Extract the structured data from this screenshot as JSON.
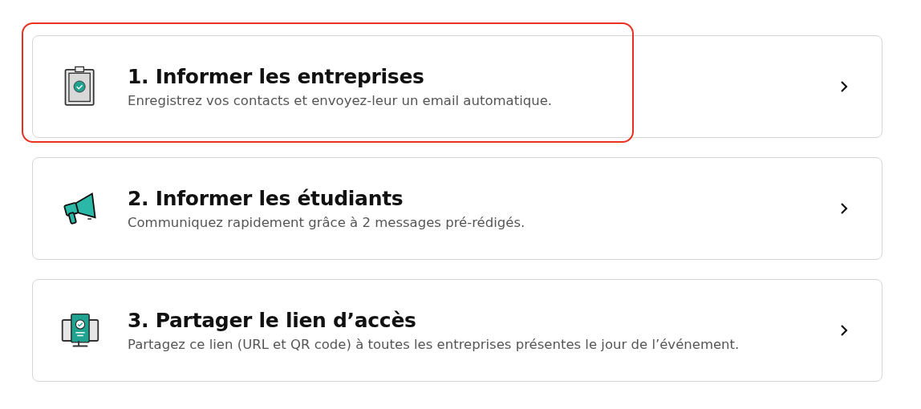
{
  "steps": [
    {
      "kind": "clipboard",
      "title": "1. Informer les entreprises",
      "description": "Enregistrez vos contacts et envoyez-leur un email automatique.",
      "highlighted": true
    },
    {
      "kind": "megaphone",
      "title": "2. Informer les étudiants",
      "description": "Communiquez rapidement grâce à 2 messages pré-rédigés.",
      "highlighted": false
    },
    {
      "kind": "monitor",
      "title": "3. Partager le lien d’accès",
      "description": "Partagez ce lien (URL et QR code) à toutes les entreprises présentes le jour de l’événement.",
      "highlighted": false
    }
  ]
}
